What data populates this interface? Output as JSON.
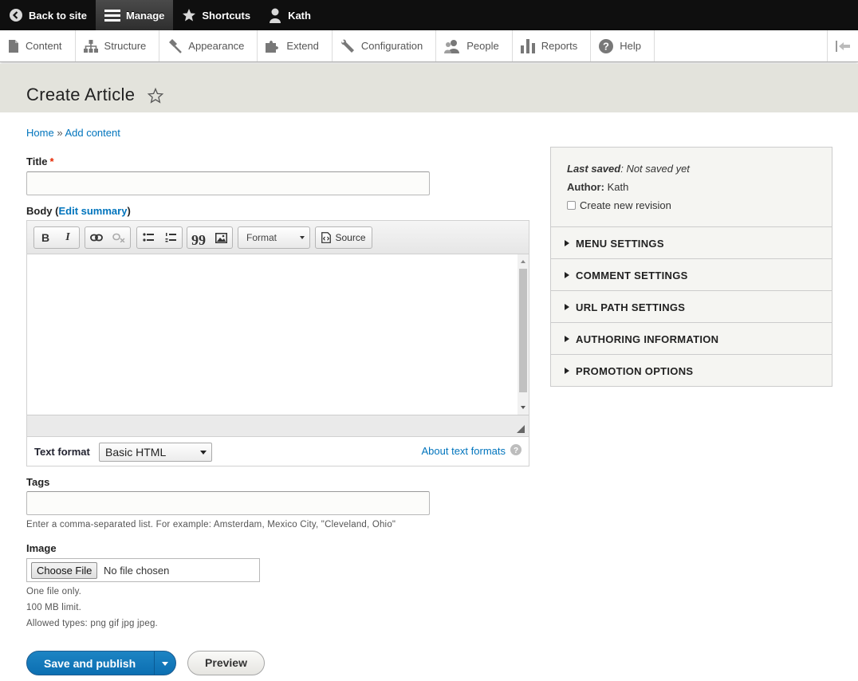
{
  "toolbar": {
    "back_to_site": "Back to site",
    "manage": "Manage",
    "shortcuts": "Shortcuts",
    "user": "Kath"
  },
  "tray": {
    "items": [
      {
        "label": "Content",
        "icon": "file-icon"
      },
      {
        "label": "Structure",
        "icon": "structure-icon"
      },
      {
        "label": "Appearance",
        "icon": "paintbrush-icon"
      },
      {
        "label": "Extend",
        "icon": "puzzle-icon"
      },
      {
        "label": "Configuration",
        "icon": "wrench-icon"
      },
      {
        "label": "People",
        "icon": "people-icon"
      },
      {
        "label": "Reports",
        "icon": "bar-chart-icon"
      },
      {
        "label": "Help",
        "icon": "help-icon"
      }
    ]
  },
  "page": {
    "title": "Create Article"
  },
  "breadcrumb": {
    "home": "Home",
    "sep": "»",
    "add_content": "Add content"
  },
  "form": {
    "title_label": "Title",
    "required_mark": "*",
    "title_value": "",
    "body_label": "Body",
    "body_open": "(",
    "edit_summary": "Edit summary",
    "body_close": ")",
    "editor": {
      "format_label": "Format",
      "source_label": "Source"
    },
    "text_format_label": "Text format",
    "text_format_value": "Basic HTML",
    "about_text_formats": "About text formats",
    "tags_label": "Tags",
    "tags_value": "",
    "tags_description": "Enter a comma-separated list. For example: Amsterdam, Mexico City, \"Cleveland, Ohio\"",
    "image_label": "Image",
    "choose_file": "Choose File",
    "no_file": "No file chosen",
    "file_help": [
      "One file only.",
      "100 MB limit.",
      "Allowed types: png gif jpg jpeg."
    ],
    "save_publish": "Save and publish",
    "preview": "Preview"
  },
  "sidebar": {
    "last_saved_label": "Last saved",
    "last_saved_value": "Not saved yet",
    "author_label": "Author",
    "author_value": "Kath",
    "create_revision": "Create new revision",
    "sections": [
      "MENU SETTINGS",
      "COMMENT SETTINGS",
      "URL PATH SETTINGS",
      "AUTHORING INFORMATION",
      "PROMOTION OPTIONS"
    ]
  },
  "colors": {
    "toolbar_bg": "#0f0f0f",
    "link": "#0074bd",
    "primary_button": "#0c6fb2",
    "header_bg": "#e3e3dc",
    "required": "#e62600"
  }
}
